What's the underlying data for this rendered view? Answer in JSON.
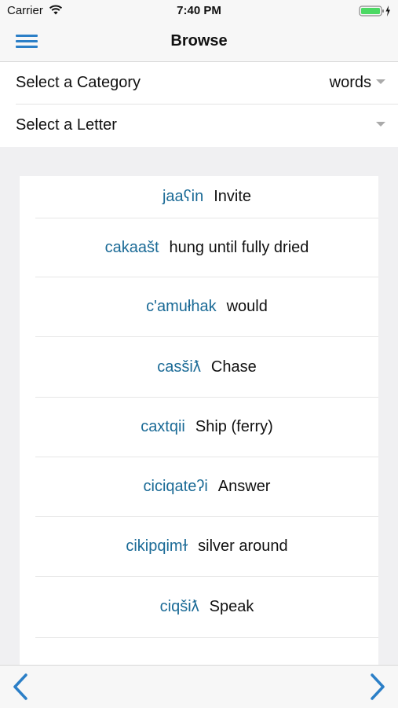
{
  "status": {
    "carrier": "Carrier",
    "time": "7:40 PM"
  },
  "nav": {
    "title": "Browse"
  },
  "filters": {
    "category_label": "Select a Category",
    "category_value": "words",
    "letter_label": "Select a Letter",
    "letter_value": ""
  },
  "entries": [
    {
      "term": "jaaʕin",
      "definition": "Invite"
    },
    {
      "term": "cakaašt",
      "definition": "hung until fully dried"
    },
    {
      "term": "c'amułhak",
      "definition": "would"
    },
    {
      "term": "casšiƛ",
      "definition": "Chase"
    },
    {
      "term": "caxtqii",
      "definition": "Ship (ferry)"
    },
    {
      "term": "ciciqateʔi",
      "definition": "Answer"
    },
    {
      "term": "cikipqimɫ",
      "definition": "silver around"
    },
    {
      "term": "ciqšiƛ",
      "definition": "Speak"
    }
  ],
  "colors": {
    "accent": "#2b7fc7",
    "term": "#1a6a96"
  },
  "icons": {
    "menu": "hamburger-menu-icon",
    "prev": "chevron-left-icon",
    "next": "chevron-right-icon"
  }
}
